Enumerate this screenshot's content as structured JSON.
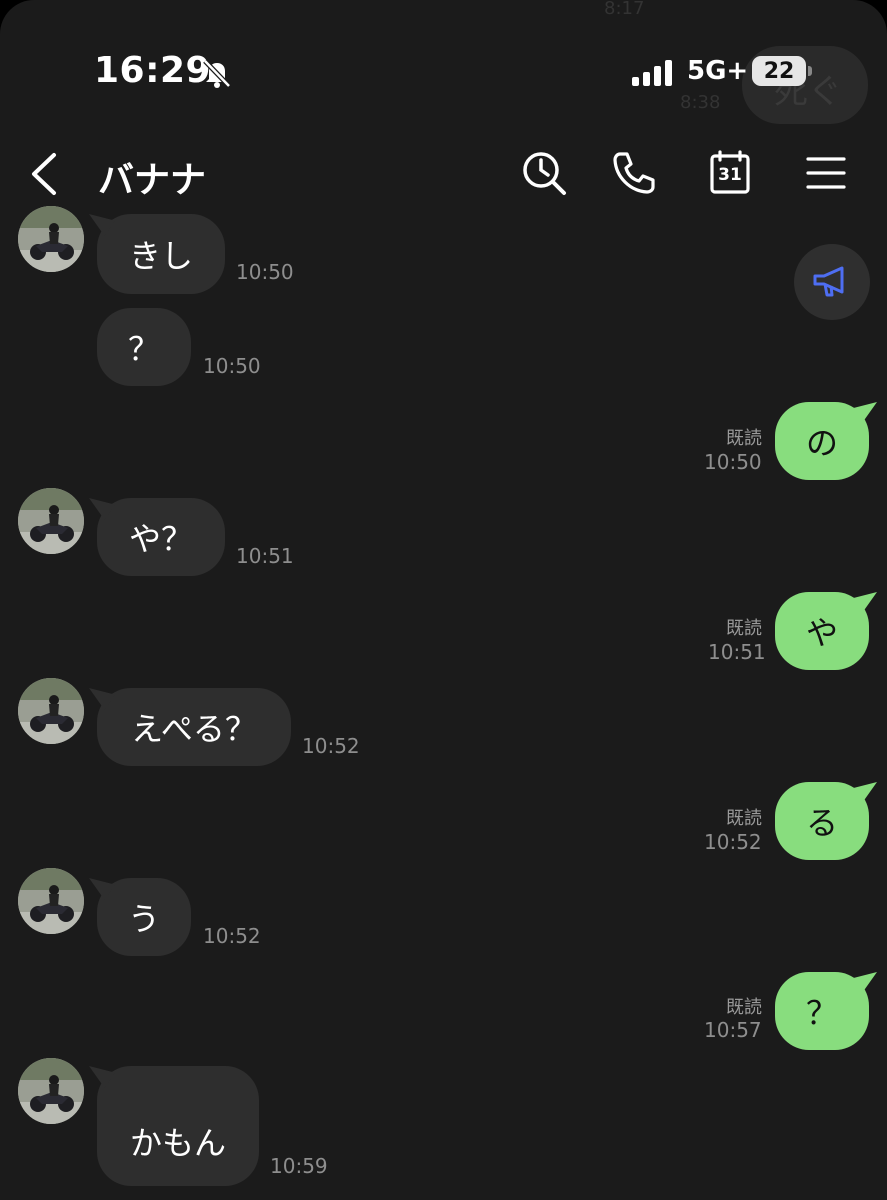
{
  "ghost": {
    "time_top": "8:17",
    "time_mid": "8:38",
    "bubble_text": "死ぐ"
  },
  "status_bar": {
    "time": "16:29",
    "network": "5G+",
    "battery": "22"
  },
  "header": {
    "title": "バナナ",
    "calendar_day": "31"
  },
  "messages": [
    {
      "side": "in",
      "avatar": false,
      "text": "きし",
      "time": "10:50"
    },
    {
      "side": "in",
      "avatar": false,
      "text": "？",
      "time": "10:50"
    },
    {
      "side": "out",
      "text": "の",
      "read": "既読",
      "time": "10:50"
    },
    {
      "side": "in",
      "avatar": true,
      "text": "や？",
      "time": "10:51"
    },
    {
      "side": "out",
      "text": "や",
      "read": "既読",
      "time": "10:51"
    },
    {
      "side": "in",
      "avatar": true,
      "text": "えぺる？",
      "time": "10:52"
    },
    {
      "side": "out",
      "text": "る",
      "read": "既読",
      "time": "10:52"
    },
    {
      "side": "in",
      "avatar": true,
      "text": "う",
      "time": "10:52"
    },
    {
      "side": "out",
      "text": "？",
      "read": "既読",
      "time": "10:57"
    },
    {
      "side": "in",
      "avatar": true,
      "text": "かもん",
      "time": "10:59"
    }
  ],
  "colors": {
    "background": "#1b1b1b",
    "incoming_bubble": "#2e2e2e",
    "outgoing_bubble": "#88dd7e",
    "announce_icon": "#4e6ef2"
  },
  "icons": [
    "bell-slash-icon",
    "signal-icon",
    "battery-icon",
    "back-chevron-icon",
    "search-history-icon",
    "phone-icon",
    "calendar-icon",
    "hamburger-menu-icon",
    "megaphone-icon"
  ]
}
